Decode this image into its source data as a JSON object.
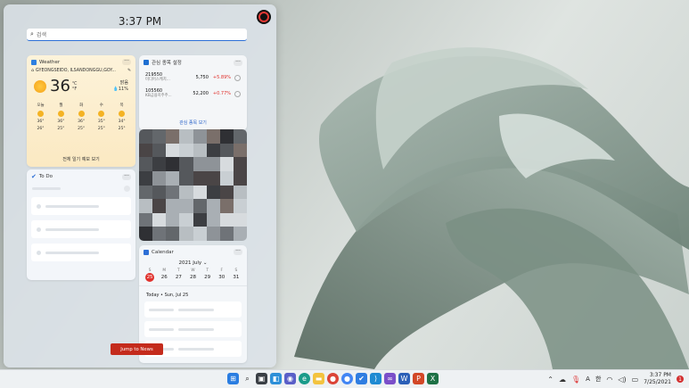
{
  "board": {
    "time": "3:37 PM",
    "search_placeholder": "검색",
    "jump_label": "Jump to News"
  },
  "weather": {
    "title": "Weather",
    "location": "GYEONGSEIDO, ILSANDONGGU,GOY...",
    "temp": "36",
    "unit_c": "℃",
    "unit_f": "°F",
    "condition": "맑음",
    "precip": "11%",
    "forecast": [
      {
        "day": "오늘",
        "hi": "36°",
        "lo": "26°"
      },
      {
        "day": "월",
        "hi": "36°",
        "lo": "25°"
      },
      {
        "day": "화",
        "hi": "36°",
        "lo": "25°"
      },
      {
        "day": "수",
        "hi": "35°",
        "lo": "25°"
      },
      {
        "day": "목",
        "hi": "34°",
        "lo": "25°"
      }
    ],
    "footer": "전체 일기 예보 보기"
  },
  "stocks": {
    "title": "관심 종목 설정",
    "items": [
      {
        "code": "219550",
        "name": "미디어스케치...",
        "price": "5,750",
        "change": "+5.89%"
      },
      {
        "code": "105560",
        "name": "KB금융지주주...",
        "price": "52,200",
        "change": "+0.77%"
      }
    ],
    "footer": "관심 종목 보기"
  },
  "todo": {
    "title": "To Do"
  },
  "calendar": {
    "title": "Calendar",
    "month": "2021 July",
    "weekdays": [
      "S",
      "M",
      "T",
      "W",
      "T",
      "F",
      "S"
    ],
    "days": [
      "25",
      "26",
      "27",
      "28",
      "29",
      "30",
      "31"
    ],
    "today_label": "Today • Sun, Jul 25"
  },
  "taskbar": {
    "time": "3:37 PM",
    "date": "7/25/2021",
    "lang": "A",
    "ime": "한",
    "notifications": "1"
  },
  "colors": {
    "accent": "#2d6fd6",
    "jump_button": "#c42b1c",
    "stock_up": "#e0312c"
  }
}
